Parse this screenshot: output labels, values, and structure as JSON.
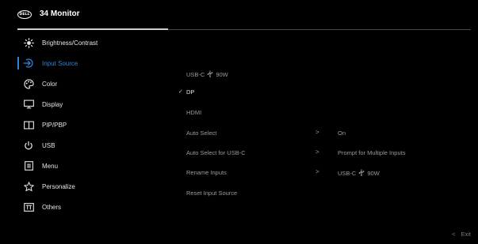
{
  "header": {
    "brand": "DELL",
    "title": "34 Monitor"
  },
  "sidebar": {
    "items": [
      {
        "label": "Brightness/Contrast",
        "icon": "brightness-icon"
      },
      {
        "label": "Input Source",
        "icon": "input-source-icon"
      },
      {
        "label": "Color",
        "icon": "color-palette-icon"
      },
      {
        "label": "Display",
        "icon": "display-icon"
      },
      {
        "label": "PIP/PBP",
        "icon": "pip-pbp-icon"
      },
      {
        "label": "USB",
        "icon": "usb-power-icon"
      },
      {
        "label": "Menu",
        "icon": "menu-icon"
      },
      {
        "label": "Personalize",
        "icon": "star-icon"
      },
      {
        "label": "Others",
        "icon": "others-icon"
      }
    ],
    "active_index": 1
  },
  "main": {
    "inputs": [
      {
        "label": "USB-C",
        "suffix": "90W",
        "icon": "usb-glyph-icon",
        "selected": false
      },
      {
        "label": "DP",
        "selected": true
      },
      {
        "label": "HDMI",
        "selected": false
      }
    ],
    "settings": [
      {
        "label": "Auto Select",
        "value": "On"
      },
      {
        "label": "Auto Select for USB-C",
        "value": "Prompt for Multiple Inputs"
      },
      {
        "label": "Rename Inputs",
        "value_prefix": "USB-C",
        "value_suffix": "90W",
        "value_icon": "usb-glyph-icon"
      }
    ],
    "reset_label": "Reset Input Source",
    "check_mark": "✓",
    "chevron": ">"
  },
  "footer": {
    "exit_label": "Exit",
    "exit_chevron": "<"
  },
  "colors": {
    "background": "#000000",
    "accent": "#2c86d8",
    "text_primary": "#e6e6e6",
    "text_secondary": "#9a9a9a"
  }
}
